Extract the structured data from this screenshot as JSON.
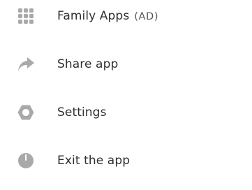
{
  "menu": {
    "items": [
      {
        "label": "Family Apps",
        "tag": "(AD)",
        "icon": "apps-grid-icon"
      },
      {
        "label": "Share app",
        "icon": "share-arrow-icon"
      },
      {
        "label": "Settings",
        "icon": "gear-icon"
      },
      {
        "label": "Exit the app",
        "icon": "power-icon"
      }
    ],
    "icon_color": "#a9a9a9",
    "text_color": "#2f2f2f"
  }
}
